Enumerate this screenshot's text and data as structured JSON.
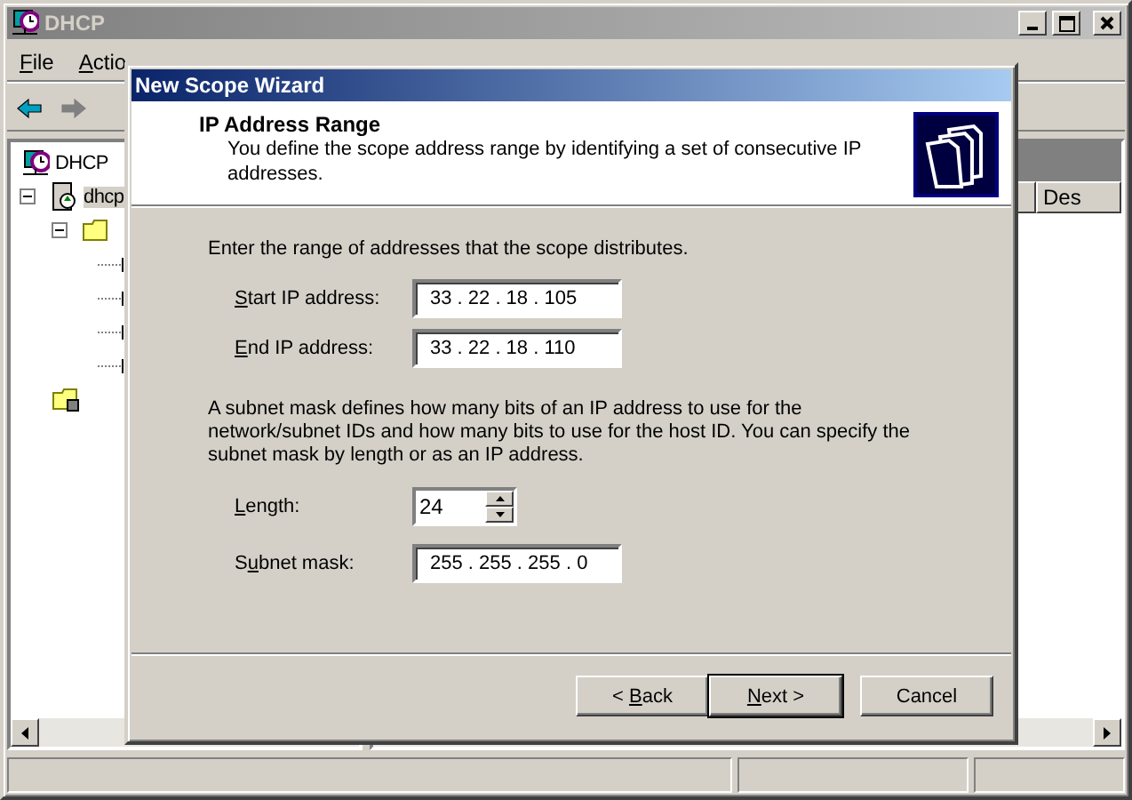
{
  "window": {
    "title": "DHCP",
    "active": false
  },
  "menu": [
    {
      "key": "F",
      "after": "ile"
    },
    {
      "key": "A",
      "after": "ctio"
    }
  ],
  "toolbar": [
    {
      "kind": "back",
      "disabled": false
    },
    {
      "kind": "forward",
      "disabled": true
    }
  ],
  "tree": [
    {
      "label": "DHCP",
      "kind": "root",
      "children": [
        {
          "label": "dhcp",
          "kind": "server",
          "expanded": true,
          "children": [
            {
              "kind": "folder",
              "expanded": true,
              "children": [
                {
                  "kind": "leaf"
                },
                {
                  "kind": "leaf"
                },
                {
                  "kind": "leaf"
                },
                {
                  "kind": "leaf"
                }
              ]
            },
            {
              "kind": "folder-db"
            }
          ]
        }
      ]
    }
  ],
  "list": {
    "columns": [
      {
        "label": "Des"
      }
    ]
  },
  "dialog": {
    "title": "New Scope Wizard",
    "heading": "IP Address Range",
    "subtitle": "You define the scope address range by identifying a set of consecutive IP addresses.",
    "intro": "Enter the range of addresses that the scope distributes.",
    "range_fields": [
      {
        "key": "S",
        "after": "tart IP address:",
        "separator": ".",
        "octets": [
          "33",
          "22",
          "18",
          "105"
        ]
      },
      {
        "key": "E",
        "after": "nd IP address:",
        "separator": ".",
        "octets": [
          "33",
          "22",
          "18",
          "110"
        ]
      }
    ],
    "mask_text": "A subnet mask defines how many bits of an IP address to use for the network/subnet IDs and how many bits to use for the host ID. You can specify the subnet mask by length or as an IP address.",
    "length": {
      "key": "L",
      "after": "ength:",
      "value": "24"
    },
    "subnet": {
      "before": "S",
      "key": "u",
      "after": "bnet mask:",
      "separator": ".",
      "octets": [
        "255",
        "255",
        "255",
        "0"
      ]
    },
    "buttons": [
      {
        "before": "< ",
        "key": "B",
        "after": "ack",
        "default": false
      },
      {
        "key": "N",
        "after": "ext >",
        "default": true
      },
      {
        "before": "Cancel",
        "default": false
      }
    ]
  }
}
